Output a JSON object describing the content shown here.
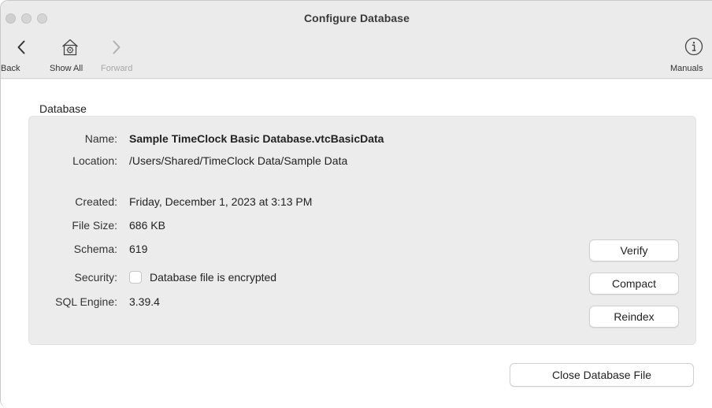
{
  "window": {
    "title": "Configure Database"
  },
  "toolbar": {
    "back_label": "Back",
    "showall_label": "Show All",
    "forward_label": "Forward",
    "manuals_label": "Manuals"
  },
  "section": {
    "label": "Database"
  },
  "fields": {
    "name_key": "Name:",
    "name_value": "Sample TimeClock Basic Database.vtcBasicData",
    "location_key": "Location:",
    "location_value": "/Users/Shared/TimeClock Data/Sample Data",
    "created_key": "Created:",
    "created_value": "Friday, December 1, 2023 at 3:13 PM",
    "filesize_key": "File Size:",
    "filesize_value": "686 KB",
    "schema_key": "Schema:",
    "schema_value": "619",
    "security_key": "Security:",
    "security_checkbox_label": "Database file is encrypted",
    "security_checked": false,
    "sqlengine_key": "SQL Engine:",
    "sqlengine_value": "3.39.4"
  },
  "buttons": {
    "verify": "Verify",
    "compact": "Compact",
    "reindex": "Reindex",
    "close_db": "Close Database File"
  },
  "icons": {
    "back": "chevron-left-icon",
    "showall": "house-gear-icon",
    "forward": "chevron-right-icon",
    "manuals": "info-circle-icon"
  }
}
